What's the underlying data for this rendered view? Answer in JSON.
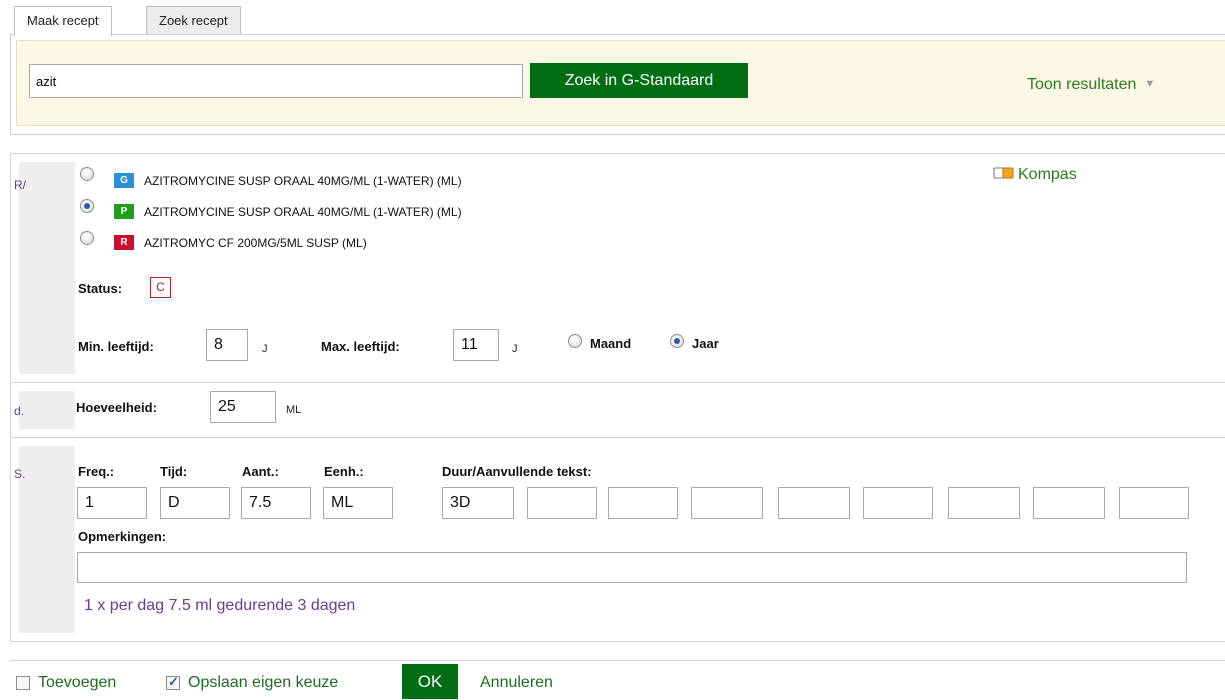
{
  "tabs": [
    {
      "label": "Maak recept",
      "active": true
    },
    {
      "label": "Zoek recept",
      "active": false
    }
  ],
  "search": {
    "value": "azit",
    "button_label": "Zoek in G-Standaard",
    "toggle_label": "Toon resultaten"
  },
  "recipe": {
    "gutter_label": "R/",
    "kompas_label": "Kompas",
    "options": [
      {
        "badge": "G",
        "badge_color": "#2b8fd3",
        "name": "AZITROMYCINE SUSP ORAAL 40MG/ML (1-WATER) (ML)",
        "selected": false
      },
      {
        "badge": "P",
        "badge_color": "#1ea01e",
        "name": "AZITROMYCINE SUSP ORAAL 40MG/ML (1-WATER) (ML)",
        "selected": true
      },
      {
        "badge": "R",
        "badge_color": "#c8102e",
        "name": "AZITROMYC CF 200MG/5ML SUSP (ML)",
        "selected": false
      }
    ],
    "status_label": "Status:",
    "status_value": "C",
    "min_age_label": "Min. leeftijd:",
    "min_age_value": "8",
    "min_age_unit": "J",
    "max_age_label": "Max. leeftijd:",
    "max_age_value": "11",
    "max_age_unit": "J",
    "age_units": [
      {
        "label": "Maand",
        "selected": false
      },
      {
        "label": "Jaar",
        "selected": true
      }
    ]
  },
  "quantity": {
    "gutter_label": "d.",
    "label": "Hoeveelheid:",
    "value": "25",
    "unit": "ML"
  },
  "dosage": {
    "gutter_label": "S.",
    "freq_label": "Freq.:",
    "freq_value": "1",
    "tijd_label": "Tijd:",
    "tijd_value": "D",
    "aant_label": "Aant.:",
    "aant_value": "7.5",
    "eenh_label": "Eenh.:",
    "eenh_value": "ML",
    "duur_label": "Duur/Aanvullende tekst:",
    "duur_values": [
      "3D",
      "",
      "",
      "",
      "",
      "",
      "",
      "",
      ""
    ],
    "remarks_label": "Opmerkingen:",
    "remarks_value": "",
    "summary": "1 x per dag 7.5 ml gedurende 3 dagen"
  },
  "footer": {
    "add_label": "Toevoegen",
    "add_checked": false,
    "save_label": "Opslaan eigen keuze",
    "save_checked": true,
    "ok_label": "OK",
    "cancel_label": "Annuleren"
  },
  "colors": {
    "accent_green": "#006d12",
    "link_green": "#2a7d1e",
    "label_purple": "#6b3b95",
    "search_bg": "#fcf8e6"
  }
}
